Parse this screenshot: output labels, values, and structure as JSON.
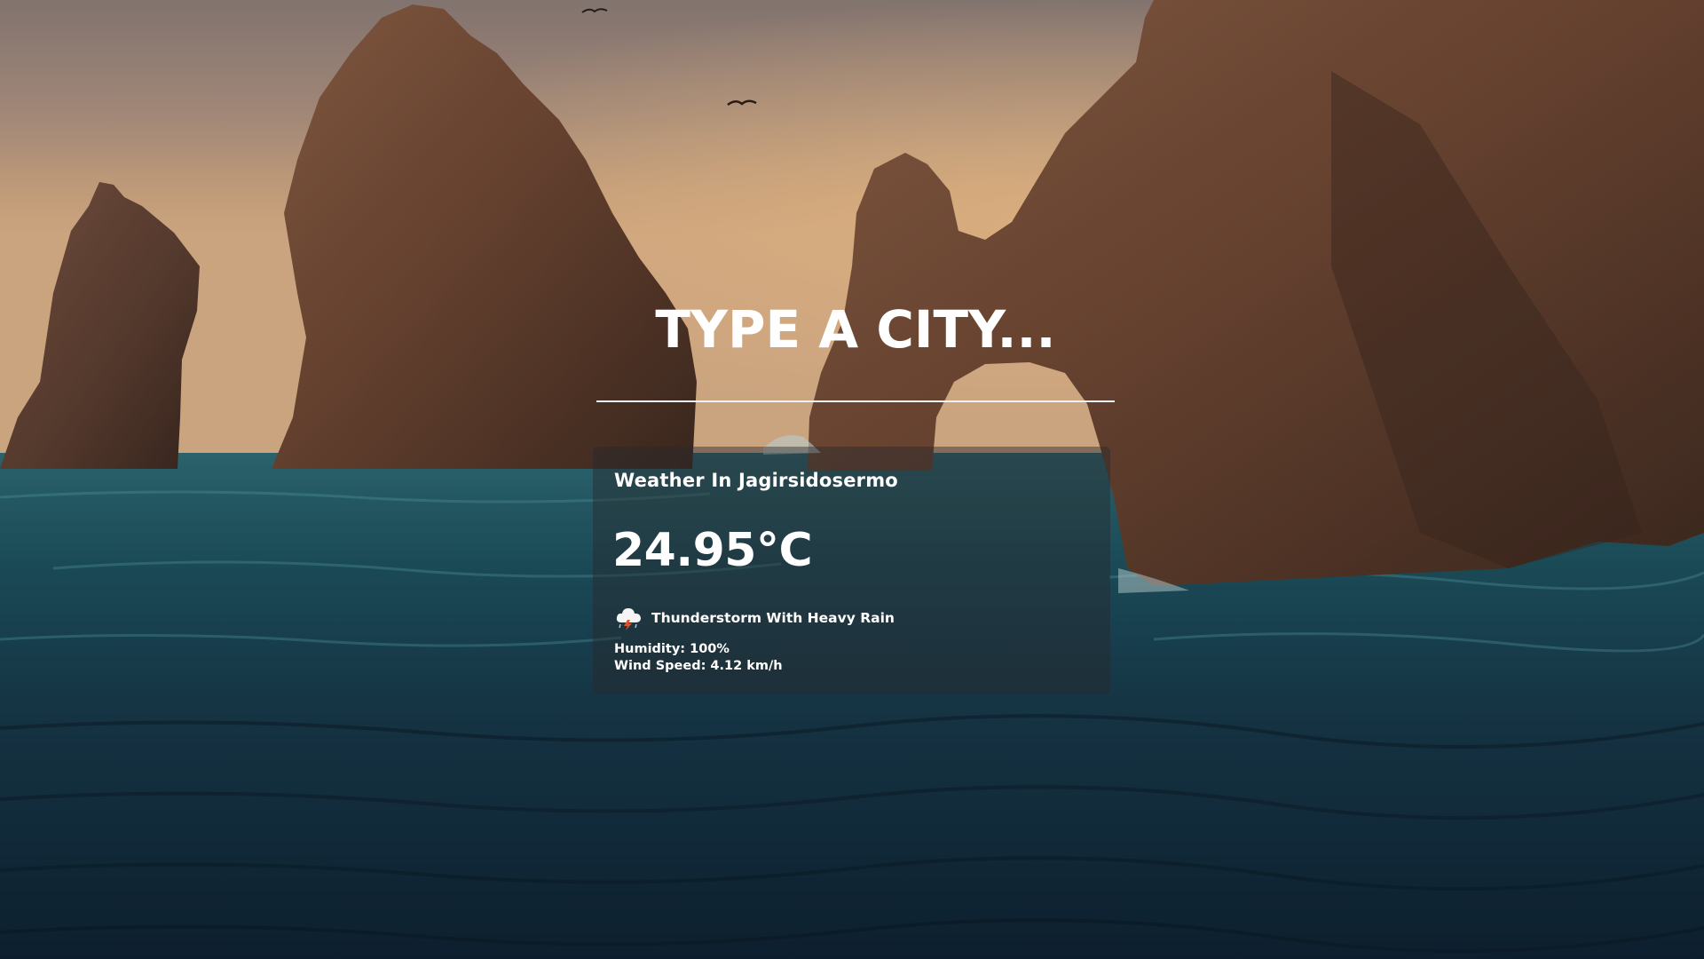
{
  "search": {
    "placeholder": "TYPE A CITY..."
  },
  "weather": {
    "city_heading": "Weather In Jagirsidosermo",
    "temperature": "24.95°C",
    "icon": "thunderstorm-cloud-icon",
    "description": "Thunderstorm With Heavy Rain",
    "humidity": "Humidity: 100%",
    "wind_speed": "Wind Speed: 4.12 km/h"
  },
  "colors": {
    "text": "#ffffff",
    "card_background": "rgba(40,40,44,0.45)",
    "underline": "#f2f2f2"
  }
}
